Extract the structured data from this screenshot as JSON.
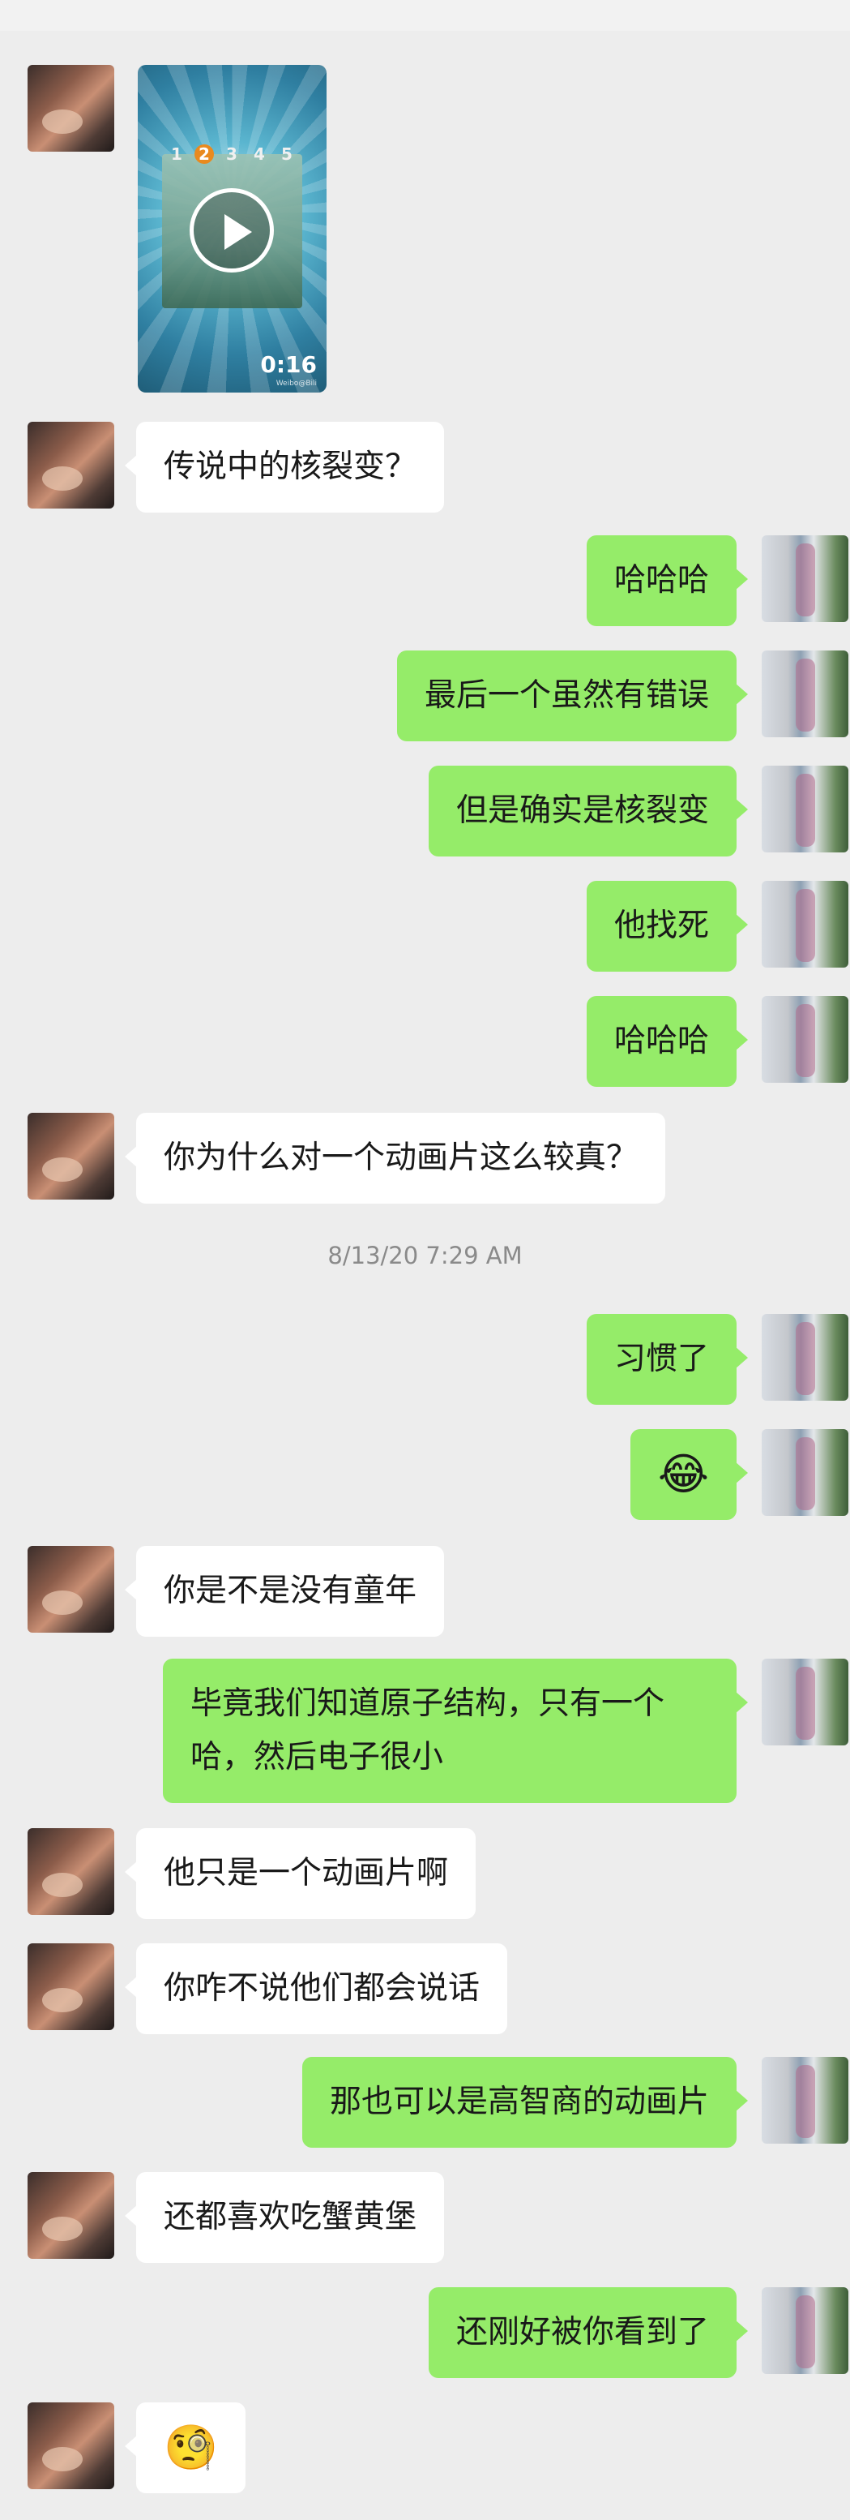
{
  "video": {
    "duration": "0:16",
    "steps": [
      "1",
      "2",
      "3",
      "4",
      "5"
    ],
    "active_step": "2",
    "watermark": "Weibo@Bili"
  },
  "timestamp": "8/13/20 7:29 AM",
  "messages": [
    {
      "side": "left",
      "text": "传说中的核裂变？"
    },
    {
      "side": "right",
      "text": "哈哈哈"
    },
    {
      "side": "right",
      "text": "最后一个虽然有错误"
    },
    {
      "side": "right",
      "text": "但是确实是核裂变"
    },
    {
      "side": "right",
      "text": "他找死"
    },
    {
      "side": "right",
      "text": "哈哈哈"
    },
    {
      "side": "left",
      "text": "你为什么对一个动画片这么较真？"
    },
    {
      "side": "right",
      "text": "习惯了"
    },
    {
      "side": "right",
      "text": "😂"
    },
    {
      "side": "left",
      "text": "你是不是没有童年"
    },
    {
      "side": "right",
      "text": "毕竟我们知道原子结构，只有一个哈，然后电子很小"
    },
    {
      "side": "left",
      "text": "他只是一个动画片啊"
    },
    {
      "side": "left",
      "text": "你咋不说他们都会说话"
    },
    {
      "side": "right",
      "text": "那也可以是高智商的动画片"
    },
    {
      "side": "left",
      "text": "还都喜欢吃蟹黄堡"
    },
    {
      "side": "right",
      "text": "还刚好被你看到了"
    },
    {
      "side": "left",
      "text": "🧐"
    }
  ],
  "colors": {
    "background": "#ededed",
    "sent_bubble": "#95ec69",
    "received_bubble": "#ffffff",
    "timestamp": "#8a8a8a"
  }
}
